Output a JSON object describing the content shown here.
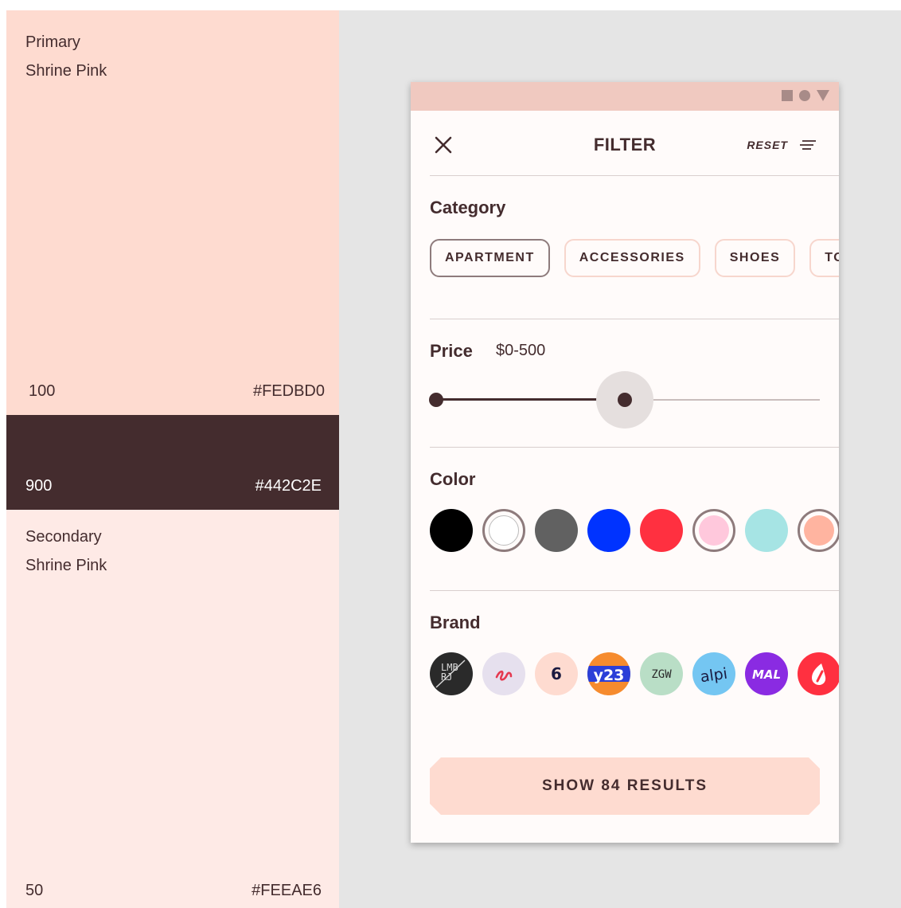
{
  "palette": {
    "primary": {
      "title_line1": "Primary",
      "title_line2": "Shrine Pink",
      "level": "100",
      "hex": "#FEDBD0"
    },
    "dark": {
      "level": "900",
      "hex": "#442C2E"
    },
    "secondary": {
      "title_line1": "Secondary",
      "title_line2": "Shrine Pink",
      "level": "50",
      "hex": "#FEEAE6"
    }
  },
  "phone": {
    "title": "FILTER",
    "reset_label": "RESET",
    "category": {
      "title": "Category",
      "chips": [
        {
          "label": "APARTMENT",
          "selected": true
        },
        {
          "label": "ACCESSORIES",
          "selected": false
        },
        {
          "label": "SHOES",
          "selected": false
        },
        {
          "label": "TO",
          "selected": false
        }
      ]
    },
    "price": {
      "title": "Price",
      "value": "$0-500",
      "range_min_fraction": 0.0,
      "range_max_fraction": 0.49
    },
    "color": {
      "title": "Color",
      "swatches": [
        "#000000",
        "#FFFFFF",
        "#616161",
        "#0033FF",
        "#FF3040",
        "#FFC8DC",
        "#A6E4E4",
        "#FFB4A0"
      ]
    },
    "brand": {
      "title": "Brand",
      "logos": [
        {
          "icon": "lmbrj-logo",
          "text": "LMBRJ"
        },
        {
          "icon": "squiggle-logo",
          "text": ""
        },
        {
          "icon": "six-logo",
          "text": "6"
        },
        {
          "icon": "y23-logo",
          "text": "y23"
        },
        {
          "icon": "zgw-logo",
          "text": "ZGW"
        },
        {
          "icon": "alpi-logo",
          "text": "alpi"
        },
        {
          "icon": "mal-logo",
          "text": "MAL"
        },
        {
          "icon": "drop-logo",
          "text": ""
        }
      ]
    },
    "cta_label": "SHOW 84 RESULTS"
  }
}
